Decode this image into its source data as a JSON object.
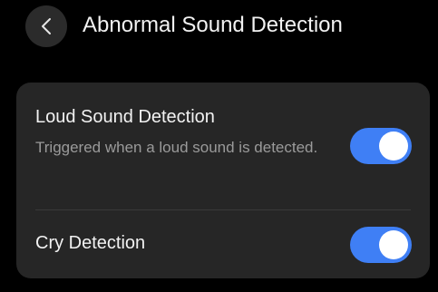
{
  "header": {
    "title": "Abnormal Sound Detection",
    "back_icon": "chevron-left-icon"
  },
  "settings": {
    "items": [
      {
        "title": "Loud Sound Detection",
        "description": "Triggered when a loud sound is detected.",
        "enabled": true
      },
      {
        "title": "Cry Detection",
        "enabled": true
      }
    ]
  },
  "colors": {
    "background": "#000000",
    "card": "#262626",
    "toggle_on": "#3f7ff5",
    "text_primary": "#f2f2f2",
    "text_secondary": "#9a9a9a"
  }
}
